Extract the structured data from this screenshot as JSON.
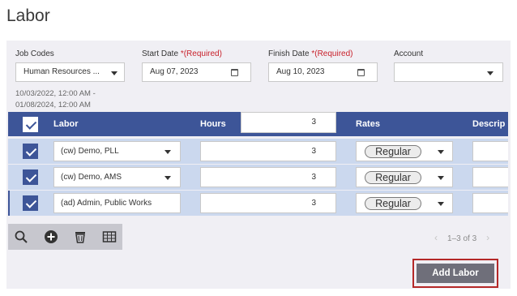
{
  "page": {
    "title": "Labor"
  },
  "filters": {
    "job_codes": {
      "label": "Job Codes",
      "value": "Human Resources ..."
    },
    "start_date": {
      "label": "Start Date",
      "required": "*(Required)",
      "value": "Aug 07, 2023"
    },
    "finish_date": {
      "label": "Finish Date",
      "required": "*(Required)",
      "value": "Aug 10, 2023"
    },
    "account": {
      "label": "Account",
      "value": ""
    },
    "date_range": {
      "line1": "10/03/2022, 12:00 AM -",
      "line2": "01/08/2024, 12:00 AM"
    }
  },
  "grid": {
    "columns": {
      "labor": "Labor",
      "hours": "Hours",
      "rates": "Rates",
      "description": "Descrip"
    },
    "header_hours_value": "3",
    "rows": [
      {
        "labor": "(cw) Demo, PLL",
        "hours": "3",
        "rate": "Regular",
        "checked": true
      },
      {
        "labor": "(cw) Demo, AMS",
        "hours": "3",
        "rate": "Regular",
        "checked": true
      },
      {
        "labor": "(ad) Admin, Public Works",
        "hours": "3",
        "rate": "Regular",
        "checked": true
      }
    ]
  },
  "toolbar": {
    "icons": [
      "search-icon",
      "add-icon",
      "delete-icon",
      "table-icon"
    ]
  },
  "pager": {
    "text": "1–3 of 3"
  },
  "actions": {
    "add_labor": "Add Labor"
  },
  "colors": {
    "header": "#3d5598",
    "row": "#cbd8ee",
    "accent_required": "#c8202a",
    "highlight_border": "#b42828"
  }
}
